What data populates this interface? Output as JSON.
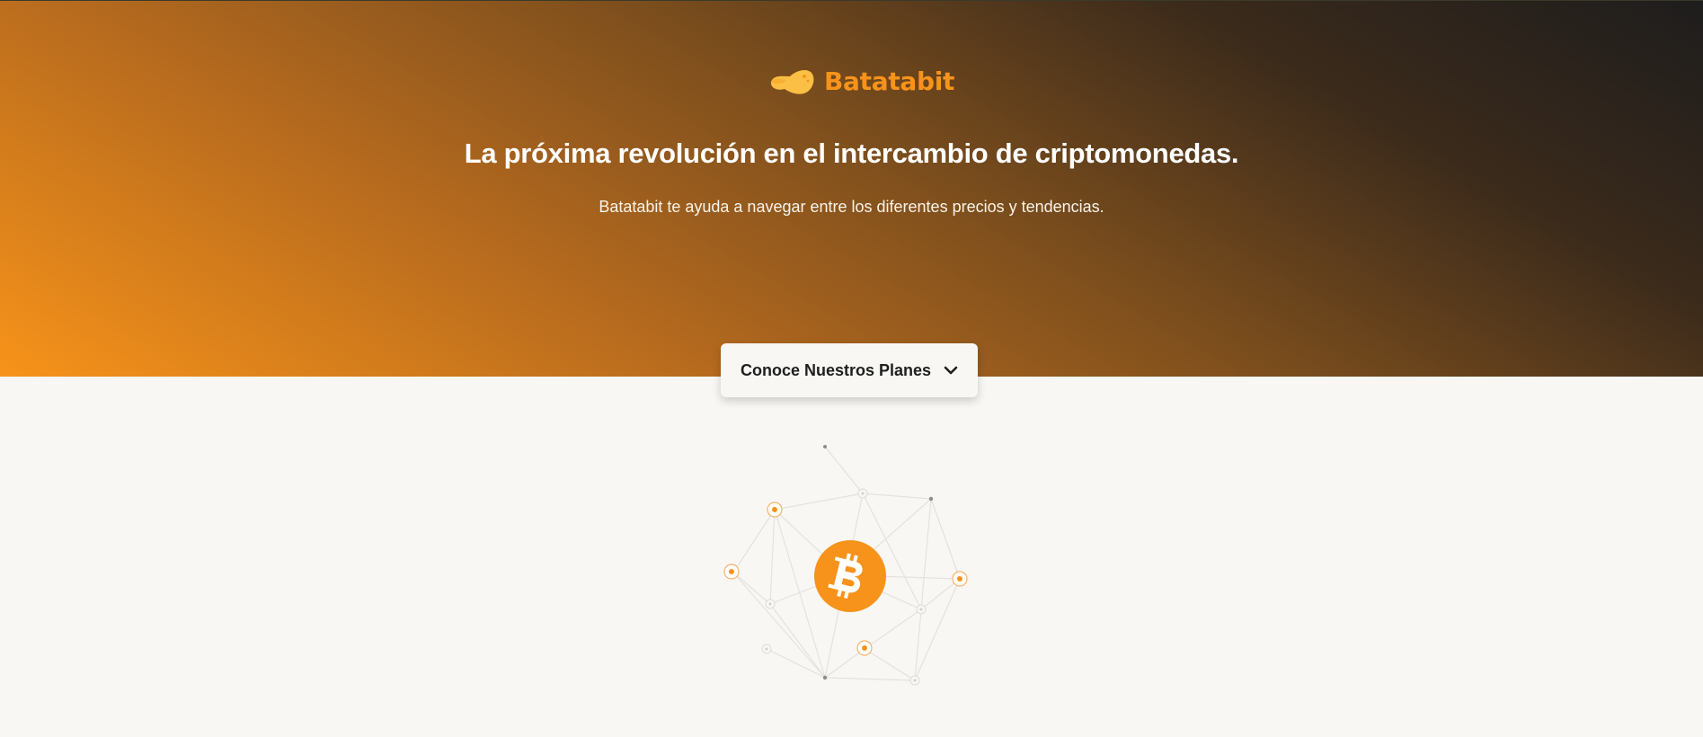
{
  "header": {
    "logo_text": "Batatabit",
    "logo_icon": "potato-icon",
    "title": "La próxima revolución en el intercambio de criptomonedas.",
    "subtitle": "Batatabit te ayuda a navegar entre los diferentes precios y tendencias."
  },
  "plans_button": {
    "label": "Conoce Nuestros Planes",
    "icon": "chevron-down-icon"
  },
  "illustration": {
    "center_icon": "bitcoin-icon",
    "type": "network-illustration"
  },
  "colors": {
    "accent": "#f7931a",
    "hero_dark": "#1e1d1d",
    "background": "#f8f7f4"
  }
}
